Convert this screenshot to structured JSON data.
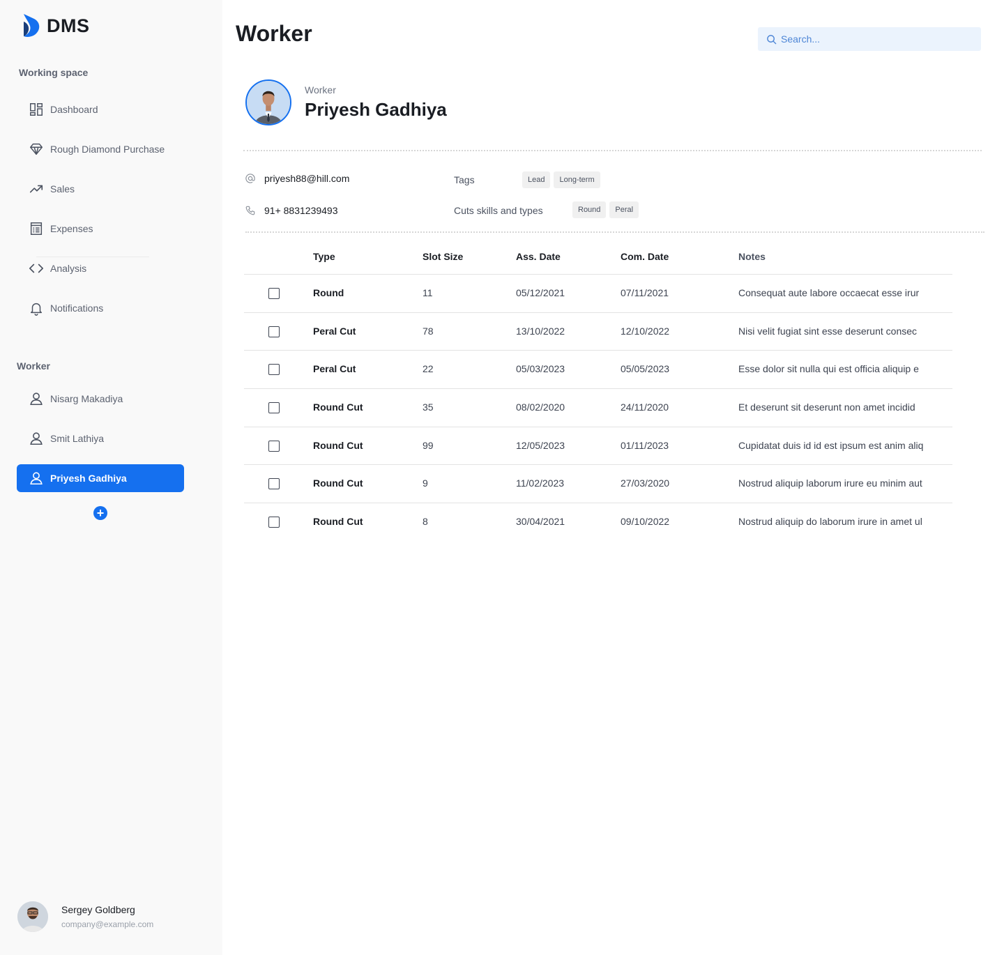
{
  "brand": {
    "name": "DMS",
    "accent": "#1570ef"
  },
  "sidebar": {
    "workspace_title": "Working space",
    "nav": [
      {
        "label": "Dashboard",
        "icon": "dashboard-icon"
      },
      {
        "label": "Rough Diamond Purchase",
        "icon": "diamond-icon"
      },
      {
        "label": "Sales",
        "icon": "trending-up-icon"
      },
      {
        "label": "Expenses",
        "icon": "receipt-icon"
      },
      {
        "label": "Analysis",
        "icon": "code-icon"
      },
      {
        "label": "Notifications",
        "icon": "bell-icon"
      }
    ],
    "worker_title": "Worker",
    "workers": [
      {
        "label": "Nisarg Makadiya",
        "icon": "user-icon"
      },
      {
        "label": "Smit Lathiya",
        "icon": "user-icon"
      },
      {
        "label": "Priyesh Gadhiya",
        "icon": "user-icon",
        "active": true
      }
    ],
    "user": {
      "name": "Sergey Goldberg",
      "email": "company@example.com"
    }
  },
  "header": {
    "title": "Worker",
    "search_placeholder": "Search..."
  },
  "profile": {
    "role": "Worker",
    "name": "Priyesh Gadhiya",
    "email": "priyesh88@hill.com",
    "phone": "91+ 8831239493",
    "tags_label": "Tags",
    "tags": [
      "Lead",
      "Long-term"
    ],
    "skills_label": "Cuts skills and types",
    "skills": [
      "Round",
      "Peral"
    ]
  },
  "table": {
    "headers": [
      "Type",
      "Slot Size",
      "Ass. Date",
      "Com. Date",
      "Notes"
    ],
    "rows": [
      {
        "type": "Round",
        "slot": "11",
        "ass": "05/12/2021",
        "com": "07/11/2021",
        "notes": "Consequat aute labore occaecat esse irur"
      },
      {
        "type": "Peral Cut",
        "slot": "78",
        "ass": "13/10/2022",
        "com": "12/10/2022",
        "notes": "Nisi velit fugiat sint esse deserunt consec"
      },
      {
        "type": "Peral Cut",
        "slot": "22",
        "ass": "05/03/2023",
        "com": "05/05/2023",
        "notes": "Esse dolor sit nulla qui est officia aliquip e"
      },
      {
        "type": "Round Cut",
        "slot": "35",
        "ass": "08/02/2020",
        "com": "24/11/2020",
        "notes": "Et deserunt sit deserunt non amet incidid"
      },
      {
        "type": "Round Cut",
        "slot": "99",
        "ass": "12/05/2023",
        "com": "01/11/2023",
        "notes": "Cupidatat duis id id est ipsum est anim aliq"
      },
      {
        "type": "Round Cut",
        "slot": "9",
        "ass": "11/02/2023",
        "com": "27/03/2020",
        "notes": "Nostrud aliquip laborum irure eu minim aut"
      },
      {
        "type": "Round Cut",
        "slot": "8",
        "ass": "30/04/2021",
        "com": "09/10/2022",
        "notes": "Nostrud aliquip do laborum irure in amet ul"
      }
    ]
  }
}
